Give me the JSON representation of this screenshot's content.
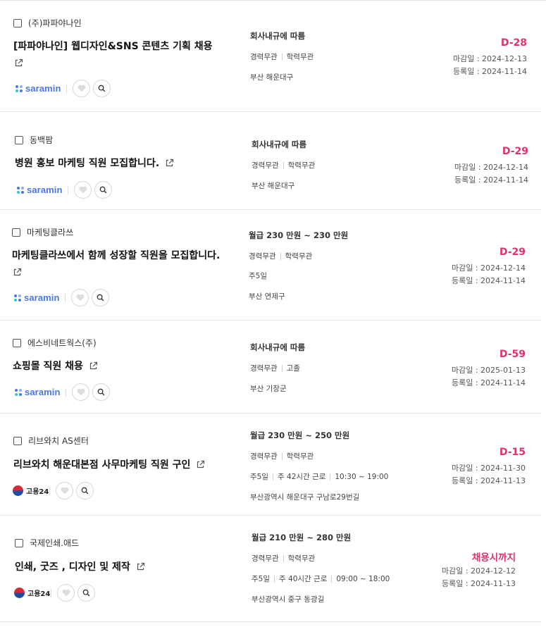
{
  "listings": [
    {
      "company": "(주)파파야나인",
      "title_line1": "[파파야나인] 웹디자인&SNS 콘텐츠 기획 채용",
      "source": "saramin",
      "salary": "회사내규에 따름",
      "conditions": [
        "경력무관",
        "학력무관"
      ],
      "schedule": [],
      "location": "부산 해운대구",
      "dday": "D-28",
      "deadline": "마감일 : 2024-12-13",
      "registered": "등록일 : 2024-11-14"
    },
    {
      "company": "동백팜",
      "title_line1": "병원 홍보 마케팅 직원 모집합니다.",
      "source": "saramin",
      "salary": "회사내규에 따름",
      "conditions": [
        "경력무관",
        "학력무관"
      ],
      "schedule": [],
      "location": "부산 해운대구",
      "dday": "D-29",
      "deadline": "마감일 : 2024-12-14",
      "registered": "등록일 : 2024-11-14"
    },
    {
      "company": "마케팅클라쓰",
      "title_line1": "마케팅클라쓰에서 함께 성장할 직원을 모집합니다.",
      "source": "saramin",
      "salary": "월급 230 만원 ~ 230 만원",
      "conditions": [
        "경력무관",
        "학력무관"
      ],
      "schedule": [
        "주5일"
      ],
      "location": "부산 연제구",
      "dday": "D-29",
      "deadline": "마감일 : 2024-12-14",
      "registered": "등록일 : 2024-11-14"
    },
    {
      "company": "에스비네트웍스(주)",
      "title_line1": "쇼핑몰 직원 채용",
      "source": "saramin",
      "salary": "회사내규에 따름",
      "conditions": [
        "경력무관",
        "고졸"
      ],
      "schedule": [],
      "location": "부산 기장군",
      "dday": "D-59",
      "deadline": "마감일 : 2025-01-13",
      "registered": "등록일 : 2024-11-14"
    },
    {
      "company": "리브와치 AS센터",
      "title_line1": "리브와치 해운대본점 사무마케팅 직원 구인",
      "source": "고용24",
      "salary": "월급 230 만원 ~ 250 만원",
      "conditions": [
        "경력무관",
        "학력무관"
      ],
      "schedule": [
        "주5일",
        "주 42시간 근로",
        "10:30 ~ 19:00"
      ],
      "location": "부산광역시 해운대구 구남로29번길",
      "dday": "D-15",
      "deadline": "마감일 : 2024-11-30",
      "registered": "등록일 : 2024-11-13"
    },
    {
      "company": "국제인쇄.애드",
      "title_line1": "인쇄, 굿즈 , 디자인 및 제작",
      "source": "고용24",
      "salary": "월급 210 만원 ~ 280 만원",
      "conditions": [
        "경력무관",
        "학력무관"
      ],
      "schedule": [
        "주5일",
        "주 40시간 근로",
        "09:00 ~ 18:00"
      ],
      "location": "부산광역시 중구 동광길",
      "dday": "채용시까지",
      "deadline": "마감일 : 2024-12-12",
      "registered": "등록일 : 2024-11-13"
    }
  ],
  "colors": {
    "dday": "#e0336a",
    "saramin_blue": "#4a76e8",
    "divider": "#e4e4e4"
  },
  "icons": {
    "external_link": "external-link-icon",
    "bookmark": "heart-icon",
    "search": "search-icon"
  }
}
